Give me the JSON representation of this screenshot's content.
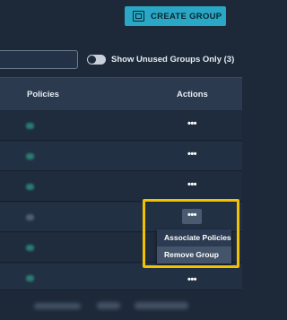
{
  "toolbar": {
    "create_label": "CREATE GROUP",
    "create_icon": "group-add-icon",
    "toggle_label": "Show Unused Groups Only (3)"
  },
  "table": {
    "columns": [
      "Policies",
      "Actions"
    ],
    "row_menu_glyph": "•••"
  },
  "dropdown": {
    "items": [
      "Associate Policies",
      "Remove Group"
    ]
  },
  "colors": {
    "accent": "#2aa7c4",
    "highlight": "#f2c200",
    "background": "#1d2939"
  }
}
